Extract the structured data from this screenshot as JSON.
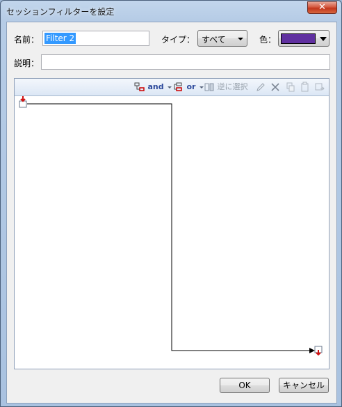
{
  "window": {
    "title": "セッションフィルターを設定",
    "close_symbol": "✕"
  },
  "form": {
    "name_label": "名前：",
    "name_value": "Filter 2",
    "type_label": "タイプ：",
    "type_value": "すべて",
    "color_label": "色：",
    "color_value": "#6030a0",
    "description_label": "説明：",
    "description_value": ""
  },
  "toolbar": {
    "and_label": "and",
    "or_label": "or",
    "invert_label": "逆に選択"
  },
  "buttons": {
    "ok": "OK",
    "cancel": "キャンセル"
  }
}
